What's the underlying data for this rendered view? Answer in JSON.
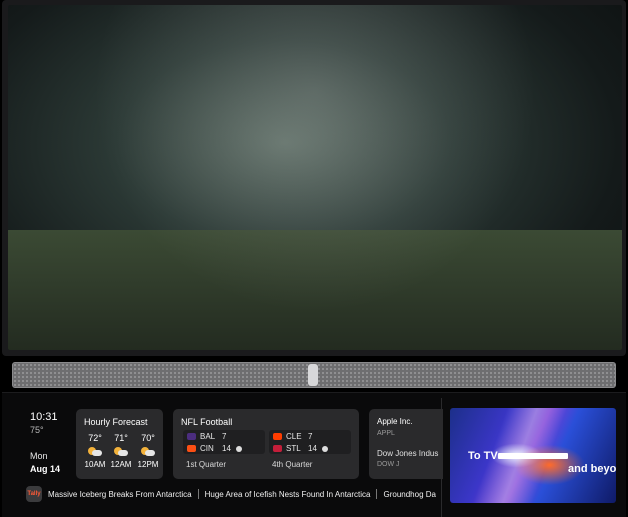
{
  "clock": {
    "time": "10:31",
    "temp": "75°",
    "day": "Mon",
    "date": "Aug 14"
  },
  "weather": {
    "title": "Hourly Forecast",
    "hours": [
      {
        "temp": "72°",
        "time": "10AM",
        "icon": "partly-cloudy-icon"
      },
      {
        "temp": "71°",
        "time": "12AM",
        "icon": "partly-cloudy-icon"
      },
      {
        "temp": "70°",
        "time": "12PM",
        "icon": "partly-cloudy-icon"
      }
    ]
  },
  "nfl": {
    "title": "NFL Football",
    "games": [
      {
        "team1": "BAL",
        "score1": "7",
        "team2": "CIN",
        "score2": "14",
        "status": "1st Quarter",
        "color1": "#4b2d7f",
        "color2": "#fb4f14"
      },
      {
        "team1": "CLE",
        "score1": "7",
        "team2": "STL",
        "score2": "14",
        "status": "4th Quarter",
        "color1": "#ff3c00",
        "color2": "#c41e3a"
      }
    ]
  },
  "stocks": {
    "items": [
      {
        "name": "Apple Inc.",
        "symbol": "APPL"
      },
      {
        "name": "Dow Jones Indus",
        "symbol": "DOW J"
      }
    ]
  },
  "ticker": {
    "brand": "Tally",
    "headlines": [
      "Massive Iceberg Breaks From Antarctica",
      "Huge Area of Icefish Nests Found In Antarctica",
      "Groundhog Da"
    ]
  },
  "promo": {
    "text_start": "To TV",
    "text_end": "and beyond."
  }
}
